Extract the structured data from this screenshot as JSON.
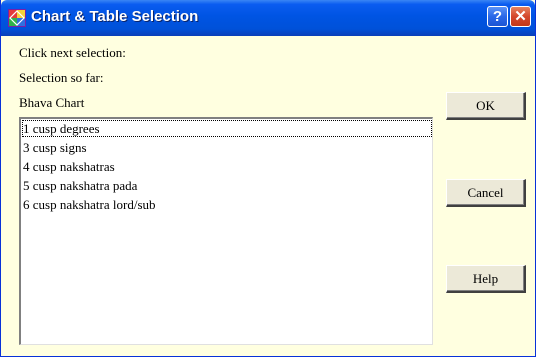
{
  "window": {
    "title": "Chart & Table Selection",
    "help_glyph": "?",
    "close_glyph": "✕"
  },
  "labels": {
    "instruction": "Click next selection:",
    "selection_so_far": "Selection so far:",
    "current_selection": "Bhava Chart"
  },
  "list": {
    "items": [
      "1 cusp degrees",
      "3 cusp signs",
      "4 cusp nakshatras",
      "5 cusp nakshatra pada",
      "6 cusp nakshatra lord/sub"
    ],
    "focused_index": 0
  },
  "buttons": {
    "ok": "OK",
    "cancel": "Cancel",
    "help": "Help"
  },
  "colors": {
    "dialog_background": "#ffffe0",
    "titlebar_blue": "#0054e3",
    "close_red": "#d4472c",
    "button_face": "#ece9d8"
  },
  "icons": {
    "app": "chart-app-icon",
    "help": "question-icon",
    "close": "close-icon"
  }
}
